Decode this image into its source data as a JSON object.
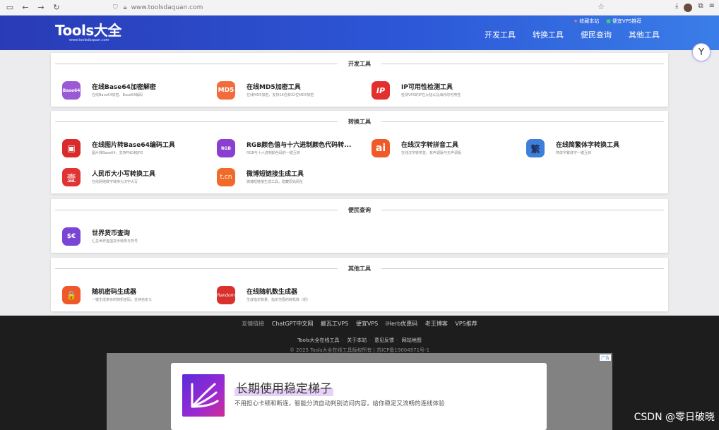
{
  "browser": {
    "url": "www.toolsdaquan.com",
    "icons": [
      "sidebar-icon",
      "back-icon",
      "forward-icon",
      "reload-icon",
      "shield-icon",
      "lock-icon",
      "star-icon",
      "download-icon",
      "avatar",
      "extensions-icon",
      "menu-icon"
    ]
  },
  "header": {
    "logo_main": "Tools大全",
    "logo_sub": "www.toolsdaquan.com",
    "top_links": [
      {
        "label": "收藏本站"
      },
      {
        "label": "便宜VPS推荐"
      }
    ],
    "nav": [
      "开发工具",
      "转换工具",
      "便民查询",
      "其他工具"
    ]
  },
  "sections": [
    {
      "title": "开发工具",
      "tools": [
        {
          "name": "在线Base64加密解密",
          "desc": "在线Base64加密、Base64解码",
          "icon_text": "Base64",
          "color": "#9b59d6"
        },
        {
          "name": "在线MD5加密工具",
          "desc": "在线MD5加密，支持16位和32位MD5加密",
          "icon_text": "MD5",
          "color": "#f26b3a"
        },
        {
          "name": "IP可用性检测工具",
          "desc": "检测VPS的IP在大陆以及海外的可用性",
          "icon_text": "IP",
          "color": "#e2302f"
        }
      ]
    },
    {
      "title": "转换工具",
      "tools": [
        {
          "name": "在线图片转Base64编码工具",
          "desc": "图片转Base64，支持PNG和JPG",
          "icon_text": "▣",
          "color": "#d92b2b"
        },
        {
          "name": "RGB颜色值与十六进制颜色代码转...",
          "desc": "RGB与十六进制颜色码的一键互转",
          "icon_text": "RGB",
          "color": "#8a3fd1"
        },
        {
          "name": "在线汉字转拼音工具",
          "desc": "在线汉字转拼音，有声调版与无声调版",
          "icon_text": "ai",
          "color": "#f05a28"
        },
        {
          "name": "在线简繁体字转换工具",
          "desc": "简体字繁体字一键互转",
          "icon_text": "繁",
          "color": "#3d7fd9"
        },
        {
          "name": "人民币大小写转换工具",
          "desc": "在线网络数字转换为汉字大写",
          "icon_text": "壹",
          "color": "#e03434"
        },
        {
          "name": "微博短链接生成工具",
          "desc": "微博短链接生成工具，隐藏原始网址",
          "icon_text": "t.cn",
          "color": "#f26a2a"
        }
      ]
    },
    {
      "title": "便民查询",
      "tools": [
        {
          "name": "世界货币查询",
          "desc": "汇总世界各国货币种类与符号",
          "icon_text": "$€",
          "color": "#7a45d4"
        }
      ]
    },
    {
      "title": "其他工具",
      "tools": [
        {
          "name": "随机密码生成器",
          "desc": "一键生成复杂的随机密码，支持自定义",
          "icon_text": "🔒",
          "color": "#f0582a"
        },
        {
          "name": "在线随机数生成器",
          "desc": "生成指定数量、指定范围的随机数（组）",
          "icon_text": "Random",
          "color": "#d9312d"
        }
      ]
    }
  ],
  "footer": {
    "friend_label": "友情链接",
    "friend_links": [
      "ChatGPT中文网",
      "搬瓦工VPS",
      "便宜VPS",
      "iHerb优惠码",
      "老王博客",
      "VPS推荐"
    ],
    "links": [
      "Tools大全在线工具",
      "关于本站",
      "意见反馈",
      "网站地图"
    ],
    "copyright": "© 2025 Tools大全在线工具版权所有 | 苏ICP备19004971号-1"
  },
  "ad": {
    "badge": "广告",
    "title": "长期使用稳定梯子",
    "desc": "不用担心卡顿和断连，智能分流自动判别访问内容，给你稳定又流畅的连线体验"
  },
  "watermark": "CSDN @零日破晓"
}
